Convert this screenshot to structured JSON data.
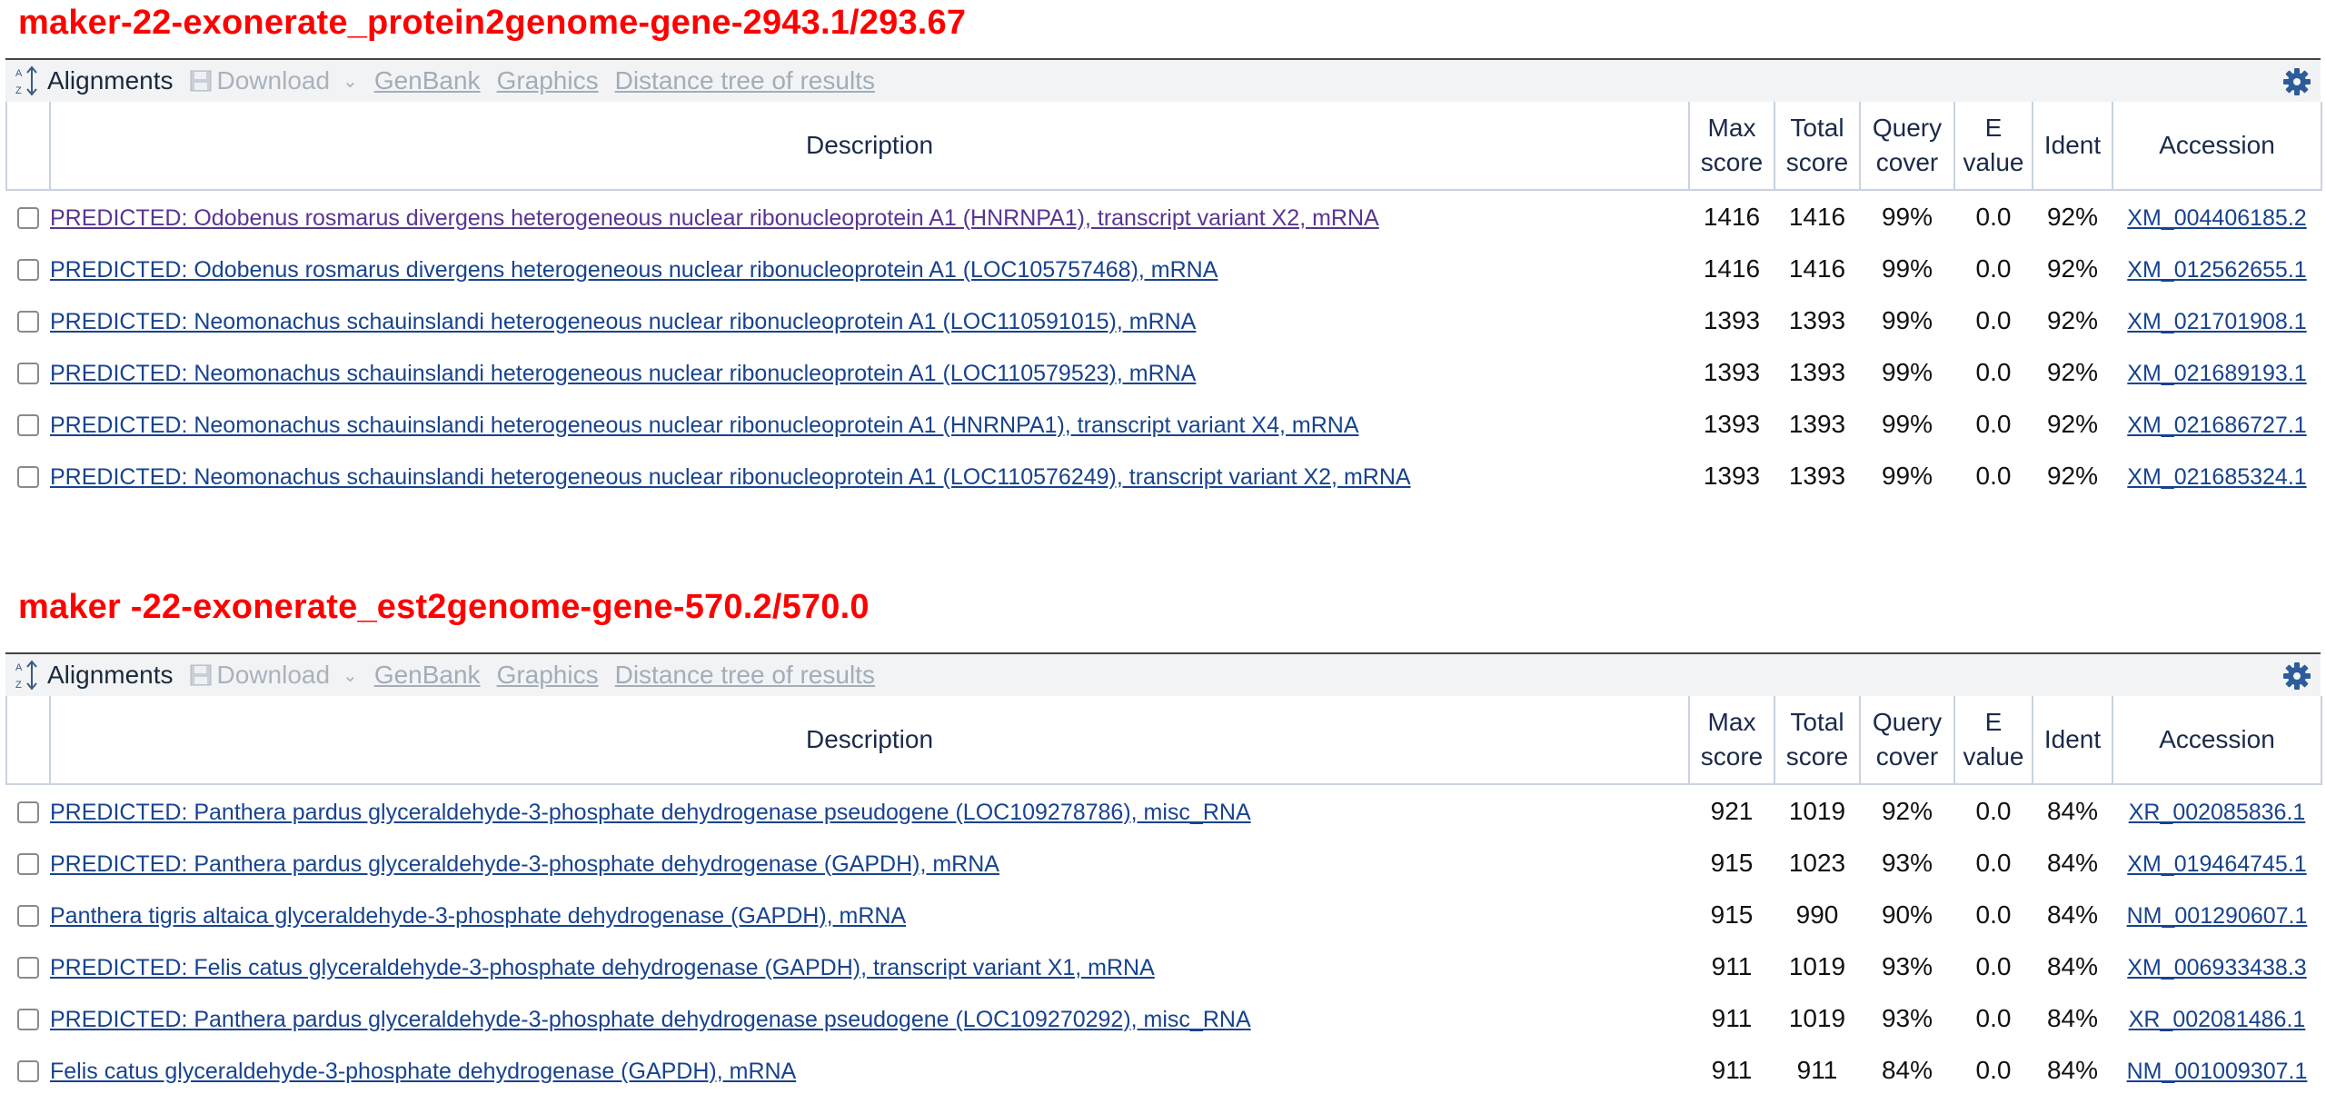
{
  "colors": {
    "title": "#ff0000",
    "link": "#17438f",
    "visited": "#5a3592",
    "toolbar_bg": "#f1f3f5"
  },
  "sections": [
    {
      "title": "maker-22-exonerate_protein2genome-gene-2943.1/293.67",
      "toolbar": {
        "alignments": "Alignments",
        "download": "Download",
        "genbank": "GenBank",
        "graphics": "Graphics",
        "distance": "Distance tree of results"
      },
      "headers": {
        "description": "Description",
        "max1": "Max",
        "max2": "score",
        "total1": "Total",
        "total2": "score",
        "query1": "Query",
        "query2": "cover",
        "e1": "E",
        "e2": "value",
        "ident": "Ident",
        "accession": "Accession"
      },
      "rows": [
        {
          "desc": "PREDICTED: Odobenus rosmarus divergens heterogeneous nuclear ribonucleoprotein A1 (HNRNPA1), transcript variant X2, mRNA",
          "max": "1416",
          "total": "1416",
          "cover": "99%",
          "evalue": "0.0",
          "ident": "92%",
          "acc": "XM_004406185.2",
          "visited": true
        },
        {
          "desc": "PREDICTED: Odobenus rosmarus divergens heterogeneous nuclear ribonucleoprotein A1 (LOC105757468), mRNA",
          "max": "1416",
          "total": "1416",
          "cover": "99%",
          "evalue": "0.0",
          "ident": "92%",
          "acc": "XM_012562655.1",
          "visited": false
        },
        {
          "desc": "PREDICTED: Neomonachus schauinslandi heterogeneous nuclear ribonucleoprotein A1 (LOC110591015), mRNA",
          "max": "1393",
          "total": "1393",
          "cover": "99%",
          "evalue": "0.0",
          "ident": "92%",
          "acc": "XM_021701908.1",
          "visited": false
        },
        {
          "desc": "PREDICTED: Neomonachus schauinslandi heterogeneous nuclear ribonucleoprotein A1 (LOC110579523), mRNA",
          "max": "1393",
          "total": "1393",
          "cover": "99%",
          "evalue": "0.0",
          "ident": "92%",
          "acc": "XM_021689193.1",
          "visited": false
        },
        {
          "desc": "PREDICTED: Neomonachus schauinslandi heterogeneous nuclear ribonucleoprotein A1 (HNRNPA1), transcript variant X4, mRNA",
          "max": "1393",
          "total": "1393",
          "cover": "99%",
          "evalue": "0.0",
          "ident": "92%",
          "acc": "XM_021686727.1",
          "visited": false
        },
        {
          "desc": "PREDICTED: Neomonachus schauinslandi heterogeneous nuclear ribonucleoprotein A1 (LOC110576249), transcript variant X2, mRNA",
          "max": "1393",
          "total": "1393",
          "cover": "99%",
          "evalue": "0.0",
          "ident": "92%",
          "acc": "XM_021685324.1",
          "visited": false
        }
      ]
    },
    {
      "title": "maker -22-exonerate_est2genome-gene-570.2/570.0",
      "toolbar": {
        "alignments": "Alignments",
        "download": "Download",
        "genbank": "GenBank",
        "graphics": "Graphics",
        "distance": "Distance tree of results"
      },
      "headers": {
        "description": "Description",
        "max1": "Max",
        "max2": "score",
        "total1": "Total",
        "total2": "score",
        "query1": "Query",
        "query2": "cover",
        "e1": "E",
        "e2": "value",
        "ident": "Ident",
        "accession": "Accession"
      },
      "rows": [
        {
          "desc": "PREDICTED: Panthera pardus glyceraldehyde-3-phosphate dehydrogenase pseudogene (LOC109278786), misc_RNA",
          "max": "921",
          "total": "1019",
          "cover": "92%",
          "evalue": "0.0",
          "ident": "84%",
          "acc": "XR_002085836.1",
          "visited": false
        },
        {
          "desc": "PREDICTED: Panthera pardus glyceraldehyde-3-phosphate dehydrogenase (GAPDH), mRNA",
          "max": "915",
          "total": "1023",
          "cover": "93%",
          "evalue": "0.0",
          "ident": "84%",
          "acc": "XM_019464745.1",
          "visited": false
        },
        {
          "desc": "Panthera tigris altaica glyceraldehyde-3-phosphate dehydrogenase (GAPDH), mRNA",
          "max": "915",
          "total": "990",
          "cover": "90%",
          "evalue": "0.0",
          "ident": "84%",
          "acc": "NM_001290607.1",
          "visited": false
        },
        {
          "desc": "PREDICTED: Felis catus glyceraldehyde-3-phosphate dehydrogenase (GAPDH), transcript variant X1, mRNA",
          "max": "911",
          "total": "1019",
          "cover": "93%",
          "evalue": "0.0",
          "ident": "84%",
          "acc": "XM_006933438.3",
          "visited": false
        },
        {
          "desc": "PREDICTED: Panthera pardus glyceraldehyde-3-phosphate dehydrogenase pseudogene (LOC109270292), misc_RNA",
          "max": "911",
          "total": "1019",
          "cover": "93%",
          "evalue": "0.0",
          "ident": "84%",
          "acc": "XR_002081486.1",
          "visited": false
        },
        {
          "desc": "Felis catus glyceraldehyde-3-phosphate dehydrogenase (GAPDH), mRNA",
          "max": "911",
          "total": "911",
          "cover": "84%",
          "evalue": "0.0",
          "ident": "84%",
          "acc": "NM_001009307.1",
          "visited": false
        }
      ]
    }
  ]
}
